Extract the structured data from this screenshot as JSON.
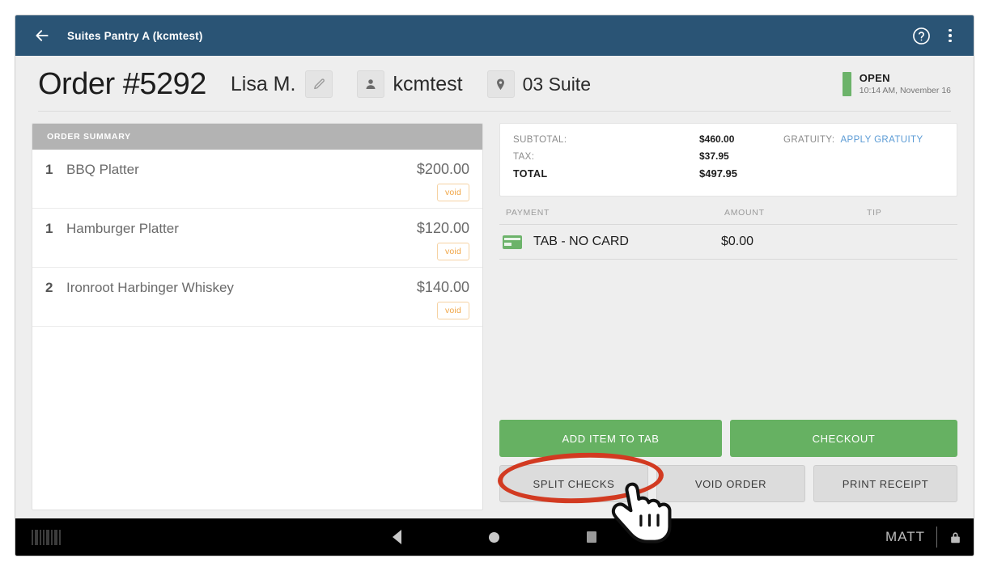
{
  "appbar": {
    "back_icon": "arrow-left-icon",
    "title": "Suites Pantry A (kcmtest)",
    "help_icon": "help-circle-icon",
    "overflow_icon": "more-vertical-icon",
    "background": "#2a5475"
  },
  "order_header": {
    "order_number": "Order #5292",
    "customer_name": "Lisa M.",
    "edit_icon": "pencil-icon",
    "user_icon": "person-icon",
    "user_name": "kcmtest",
    "location_icon": "map-pin-icon",
    "location_name": "03 Suite",
    "status_label": "OPEN",
    "status_time": "10:14 AM, November 16",
    "status_color": "#6cb36a"
  },
  "order_summary": {
    "title": "ORDER SUMMARY",
    "void_label": "void",
    "items": [
      {
        "qty": "1",
        "name": "BBQ Platter",
        "price": "$200.00"
      },
      {
        "qty": "1",
        "name": "Hamburger Platter",
        "price": "$120.00"
      },
      {
        "qty": "2",
        "name": "Ironroot Harbinger Whiskey",
        "price": "$140.00"
      }
    ]
  },
  "totals": {
    "subtotal_label": "SUBTOTAL:",
    "subtotal_value": "$460.00",
    "tax_label": "TAX:",
    "tax_value": "$37.95",
    "total_label": "TOTAL",
    "total_value": "$497.95",
    "gratuity_label": "GRATUITY:",
    "gratuity_link": "APPLY GRATUITY",
    "gratuity_link_color": "#5b9bd5"
  },
  "payments": {
    "col_payment": "PAYMENT",
    "col_amount": "AMOUNT",
    "col_tip": "TIP",
    "rows": [
      {
        "icon": "credit-card-icon",
        "name": "TAB - NO CARD",
        "amount": "$0.00",
        "tip": ""
      }
    ]
  },
  "actions": {
    "add_item": "ADD ITEM TO TAB",
    "checkout": "CHECKOUT",
    "split_checks": "SPLIT CHECKS",
    "void_order": "VOID ORDER",
    "print_receipt": "PRINT RECEIPT",
    "primary_color": "#66b162",
    "secondary_color": "#dcdcdc"
  },
  "navbar": {
    "barcode_icon": "barcode-icon",
    "back_icon": "nav-back-icon",
    "home_icon": "nav-home-icon",
    "recents_icon": "nav-recents-icon",
    "user": "MATT",
    "lock_icon": "lock-icon"
  },
  "annotation": {
    "highlight_target": "SPLIT CHECKS",
    "highlight_color": "#d23a21",
    "cursor_icon": "pointing-hand-cursor"
  }
}
